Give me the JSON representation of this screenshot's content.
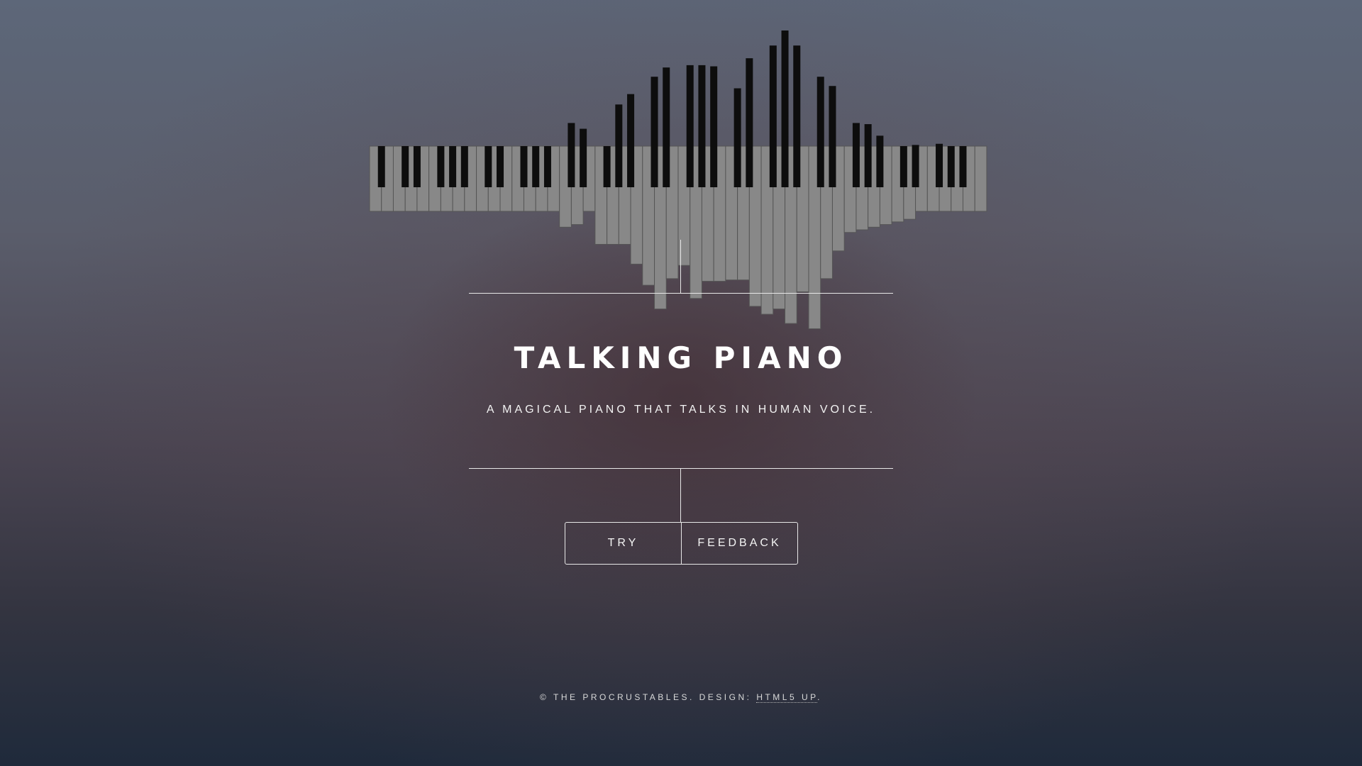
{
  "page": {
    "title": "TALKING PIANO",
    "subtitle": "A MAGICAL PIANO THAT TALKS IN HUMAN VOICE."
  },
  "logo": {
    "name": "piano-sound-wave-logo",
    "white_key_count": 52,
    "black_key_levels_above_keyboard": [
      0,
      0,
      0,
      0,
      0,
      0,
      0,
      0,
      0,
      0,
      0,
      0.2,
      0.15,
      0,
      0.36,
      0.45,
      0.6,
      0.68,
      0.7,
      0.7,
      0.69,
      0.5,
      0.76,
      0.87,
      1.0,
      0.87,
      0.6,
      0.52,
      0.2,
      0.19,
      0.09,
      0,
      0.01,
      0.02,
      0,
      0,
      0,
      0,
      0
    ],
    "white_key_levels_below_keyboard": [
      0,
      0,
      0,
      0,
      0,
      0,
      0,
      0,
      0,
      0,
      0,
      0,
      0,
      0,
      0,
      0,
      0.12,
      0.1,
      0,
      0.25,
      0.25,
      0.25,
      0.4,
      0.56,
      0.74,
      0.51,
      0.41,
      0.66,
      0.53,
      0.53,
      0.52,
      0.52,
      0.72,
      0.78,
      0.74,
      0.85,
      0.61,
      0.89,
      0.51,
      0.3,
      0.16,
      0.14,
      0.12,
      0.1,
      0.08,
      0.06,
      0,
      0,
      0,
      0,
      0,
      0
    ]
  },
  "actions": {
    "try_label": "TRY",
    "feedback_label": "FEEDBACK"
  },
  "footer": {
    "text": "© THE PROCRUSTABLES. DESIGN: ",
    "link_label": "HTML5 UP",
    "suffix": "."
  },
  "colors": {
    "white_key": "#888888",
    "white_key_border": "#555555",
    "black_key": "#0d0d0d",
    "rule_line": "#e8e8e8",
    "text": "#ffffff"
  }
}
